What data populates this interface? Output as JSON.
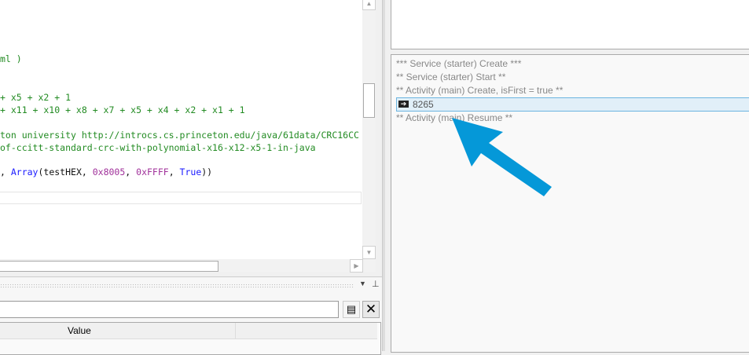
{
  "editor": {
    "lines": [
      {
        "parts": [
          {
            "c": "g",
            "t": "ml )"
          }
        ]
      },
      {
        "parts": [
          {
            "c": "g",
            "t": "+ x5 + x2 + 1"
          }
        ]
      },
      {
        "parts": [
          {
            "c": "g",
            "t": "+ x11 + x10 + x8 + x7 + x5 + x4 + x2 + x1 + 1"
          }
        ]
      },
      {
        "parts": [
          {
            "c": "g",
            "t": "ton university http://introcs.cs.princeton.edu/java/61data/CRC16CC"
          }
        ]
      },
      {
        "parts": [
          {
            "c": "g",
            "t": "of-ccitt-standard-crc-with-polynomial-x16-x12-x5-1-in-java"
          }
        ]
      },
      {
        "parts": [
          {
            "c": "t",
            "t": ", "
          },
          {
            "c": "k",
            "t": "Array"
          },
          {
            "c": "t",
            "t": "(testHEX, "
          },
          {
            "c": "n",
            "t": "0x8005"
          },
          {
            "c": "t",
            "t": ", "
          },
          {
            "c": "n",
            "t": "0xFFFF"
          },
          {
            "c": "t",
            "t": ", "
          },
          {
            "c": "k",
            "t": "True"
          },
          {
            "c": "t",
            "t": "))"
          }
        ]
      }
    ]
  },
  "bottom_panel": {
    "search_value": "",
    "column_header": "Value"
  },
  "log": {
    "lines": [
      "*** Service (starter) Create ***",
      "** Service (starter) Start **",
      "** Activity (main) Create, isFirst = true **",
      "8265",
      "** Activity (main) Resume **"
    ]
  },
  "colors": {
    "arrow": "#0598d8",
    "highlight": "#e1eff8"
  }
}
